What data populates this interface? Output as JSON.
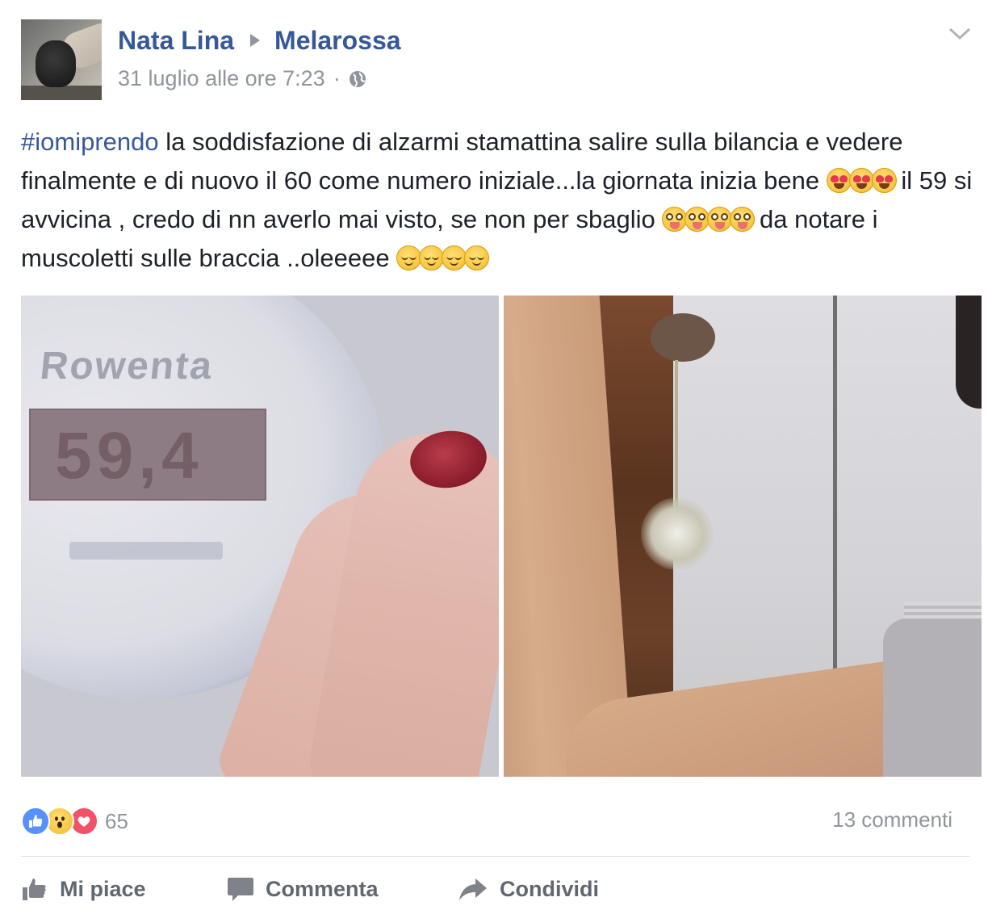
{
  "author": {
    "name": "Nata Lina",
    "group": "Melarossa"
  },
  "meta": {
    "date": "31 luglio alle ore 7:23",
    "separator": "·",
    "privacy_icon": "globe-icon"
  },
  "post": {
    "hashtag": "#iomiprendo",
    "text_1": " la soddisfazione di alzarmi stamattina salire sulla bilancia e vedere finalmente e di nuovo il 60 come numero iniziale...la giornata inizia bene ",
    "emoji_1": "heart-eyes-emoji",
    "text_2": " il 59 si avvicina , credo di nn averlo mai visto, se non per sbaglio ",
    "emoji_2": "tongue-out-emoji",
    "text_3": " da notare i muscoletti sulle braccia ..oleeeee ",
    "emoji_3": "relieved-emoji"
  },
  "photos": {
    "left": {
      "scale_brand": "Rowenta",
      "scale_reading": "59,4"
    }
  },
  "reactions": {
    "icons": [
      "like-icon",
      "wow-icon",
      "love-icon"
    ],
    "count": "65"
  },
  "comments": "13 commenti",
  "actions": {
    "like": "Mi piace",
    "comment": "Commenta",
    "share": "Condividi"
  },
  "colors": {
    "link": "#365899",
    "meta": "#90949c",
    "action": "#616770",
    "like_blue": "#5890ff",
    "love_red": "#f25268"
  }
}
